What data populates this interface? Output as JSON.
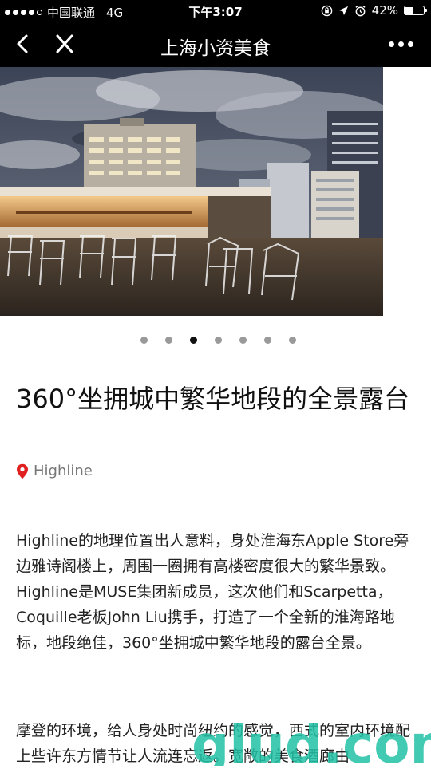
{
  "status_bar": {
    "carrier": "中国联通",
    "network": "4G",
    "time": "下午3:07",
    "battery": "42%",
    "battery_level": 0.42
  },
  "nav": {
    "title": "上海小资美食"
  },
  "hero": {
    "slide_count": 7,
    "active_index": 2
  },
  "article": {
    "title": "360°坐拥城中繁华地段的全景露台",
    "location": "Highline",
    "paragraphs": [
      "Highline的地理位置出人意料，身处淮海东Apple Store旁边雅诗阁楼上，周围一圈拥有高楼密度很大的繁华景致。Highline是MUSE集团新成员，这次他们和Scarpetta，Coquille老板John Liu携手，打造了一个全新的淮海路地标，地段绝佳，360°坐拥城中繁华地段的露台全景。",
      "摩登的环境，给人身处时尚纽约的感觉，西式的室内环境配上些许东方情节让人流连忘返。宽敞的美食酒廊由"
    ]
  },
  "watermark": {
    "text": "glud.com"
  },
  "colors": {
    "bar_bg": "#000000",
    "pin": "#e02020",
    "dot_active": "#111111",
    "dot_inactive": "#9a9a9a",
    "watermark": "#22c1a6"
  }
}
